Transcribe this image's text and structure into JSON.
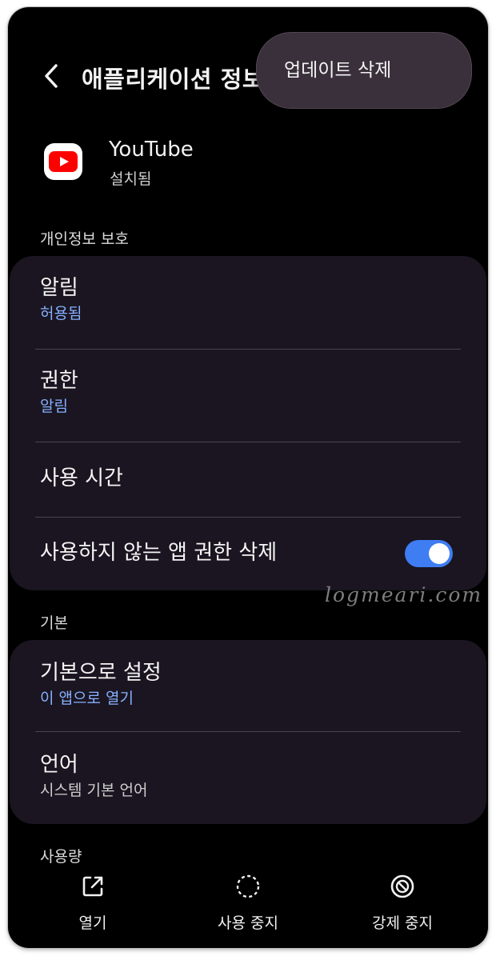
{
  "header": {
    "title": "애플리케이션 정보",
    "back_icon": "chevron-left-icon"
  },
  "popup_menu": {
    "items": [
      {
        "label": "업데이트 삭제"
      }
    ]
  },
  "app": {
    "name": "YouTube",
    "status": "설치됨",
    "icon": "youtube-play-icon",
    "brand_color": "#ff0000"
  },
  "sections": {
    "privacy": {
      "title": "개인정보 보호",
      "notifications": {
        "title": "알림",
        "subtitle": "허용됨"
      },
      "permissions": {
        "title": "권한",
        "subtitle": "알림"
      },
      "screen_time": {
        "title": "사용 시간"
      },
      "remove_permissions": {
        "title": "사용하지 않는 앱 권한 삭제",
        "toggle_on": true
      }
    },
    "basic": {
      "title": "기본",
      "set_default": {
        "title": "기본으로 설정",
        "subtitle": "이 앱으로 열기"
      },
      "language": {
        "title": "언어",
        "subtitle": "시스템 기본 언어"
      }
    },
    "usage": {
      "title": "사용량"
    }
  },
  "bottom_bar": {
    "open": {
      "label": "열기",
      "icon": "open-external-icon"
    },
    "disable": {
      "label": "사용 중지",
      "icon": "dashed-circle-icon"
    },
    "force_stop": {
      "label": "강제 중지",
      "icon": "prohibited-icon"
    }
  },
  "watermark": "logmeari.com",
  "colors": {
    "accent_blue": "#86b0ff",
    "toggle_on": "#3e7df2",
    "card_bg": "#1a1520",
    "popup_bg": "#3a303b"
  }
}
